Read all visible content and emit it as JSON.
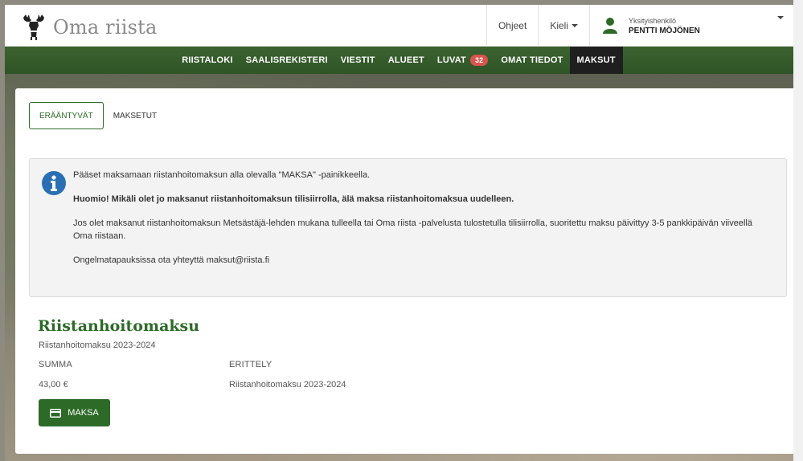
{
  "header": {
    "brand_name": "Oma riista",
    "help_label": "Ohjeet",
    "language_label": "Kieli",
    "user_role": "Yksityishenkilö",
    "user_name": "PENTTI MÖJÖNEN"
  },
  "nav": {
    "items": [
      {
        "label": "RIISTALOKI"
      },
      {
        "label": "SAALISREKISTERI"
      },
      {
        "label": "VIESTIT"
      },
      {
        "label": "ALUEET"
      },
      {
        "label": "LUVAT",
        "badge": "32"
      },
      {
        "label": "OMAT TIEDOT"
      },
      {
        "label": "MAKSUT",
        "active": true
      }
    ]
  },
  "tabs": {
    "due": "ERÄÄNTYVÄT",
    "paid": "MAKSETUT"
  },
  "alert": {
    "line1": "Pääset maksamaan riistanhoitomaksun alla olevalla \"MAKSA\" -painikkeella.",
    "line2": "Huomio! Mikäli olet jo maksanut riistanhoitomaksun tilisiirrolla, älä maksa riistanhoitomaksua uudelleen.",
    "line3": "Jos olet maksanut riistanhoitomaksun Metsästäjä-lehden mukana tulleella tai Oma riista -palvelusta tulostetulla tilisiirrolla, suoritettu maksu päivittyy 3-5 pankkipäivän viiveellä Oma riistaan.",
    "line4": "Ongelmatapauksissa ota yhteyttä maksut@riista.fi"
  },
  "payment": {
    "title": "Riistanhoitomaksu",
    "subtitle": "Riistanhoitomaksu 2023-2024",
    "sum_label": "SUMMA",
    "spec_label": "ERITTELY",
    "sum_value": "43,00 €",
    "spec_value": "Riistanhoitomaksu 2023-2024",
    "pay_button": "MAKSA"
  },
  "colors": {
    "brand_green": "#2d6a28",
    "nav_green": "#3b6330",
    "badge_red": "#d9534f",
    "active_nav": "#1f1f1f"
  },
  "icons": {
    "brand": "moose-icon",
    "user": "user-icon",
    "info": "info-icon",
    "card": "credit-card-icon"
  }
}
